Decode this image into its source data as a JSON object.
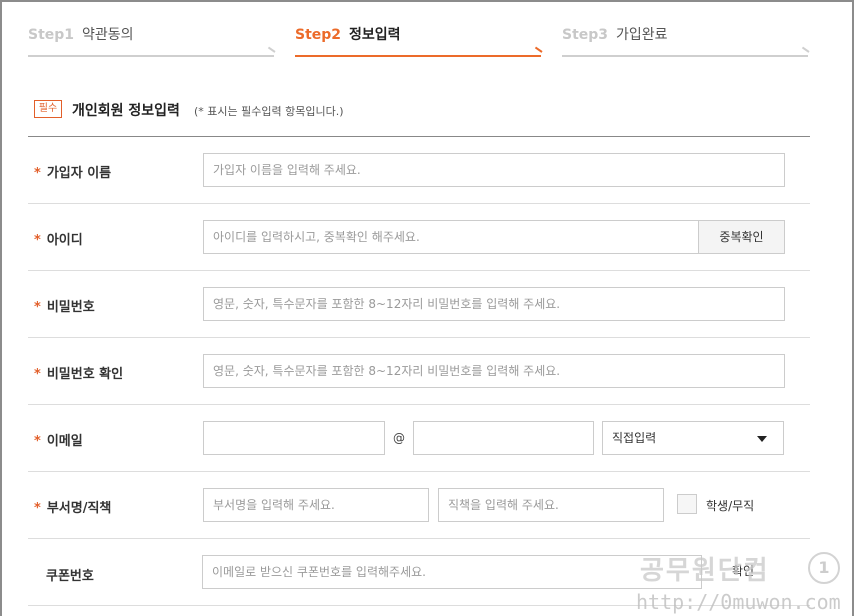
{
  "steps": [
    {
      "num": "Step1",
      "label": "약관동의"
    },
    {
      "num": "Step2",
      "label": "정보입력"
    },
    {
      "num": "Step3",
      "label": "가입완료"
    }
  ],
  "section": {
    "badge": "필수",
    "title": "개인회원 정보입력",
    "note": "(* 표시는 필수입력 항목입니다.)"
  },
  "form": {
    "required_mark": "*",
    "name": {
      "label": "가입자 이름",
      "placeholder": "가입자 이름을 입력해 주세요."
    },
    "user_id": {
      "label": "아이디",
      "placeholder": "아이디를 입력하시고, 중복확인 해주세요.",
      "button": "중복확인"
    },
    "password": {
      "label": "비밀번호",
      "placeholder": "영문, 숫자, 특수문자를 포함한 8~12자리 비밀번호를 입력해 주세요."
    },
    "password_confirm": {
      "label": "비밀번호 확인",
      "placeholder": "영문, 숫자, 특수문자를 포함한 8~12자리 비밀번호를 입력해 주세요."
    },
    "email": {
      "label": "이메일",
      "at": "@",
      "domain_select": "직접입력"
    },
    "department": {
      "label": "부서명/직책",
      "dept_placeholder": "부서명을 입력해 주세요.",
      "title_placeholder": "직책을 입력해 주세요.",
      "checkbox_label": "학생/무직"
    },
    "coupon": {
      "label": "쿠폰번호",
      "placeholder": "이메일로 받으신 쿠폰번호를 입력해주세요.",
      "button": "확인"
    }
  },
  "watermark": {
    "line1": "공무원단컴",
    "line2": "http://0muwon.com",
    "logo": "1"
  }
}
